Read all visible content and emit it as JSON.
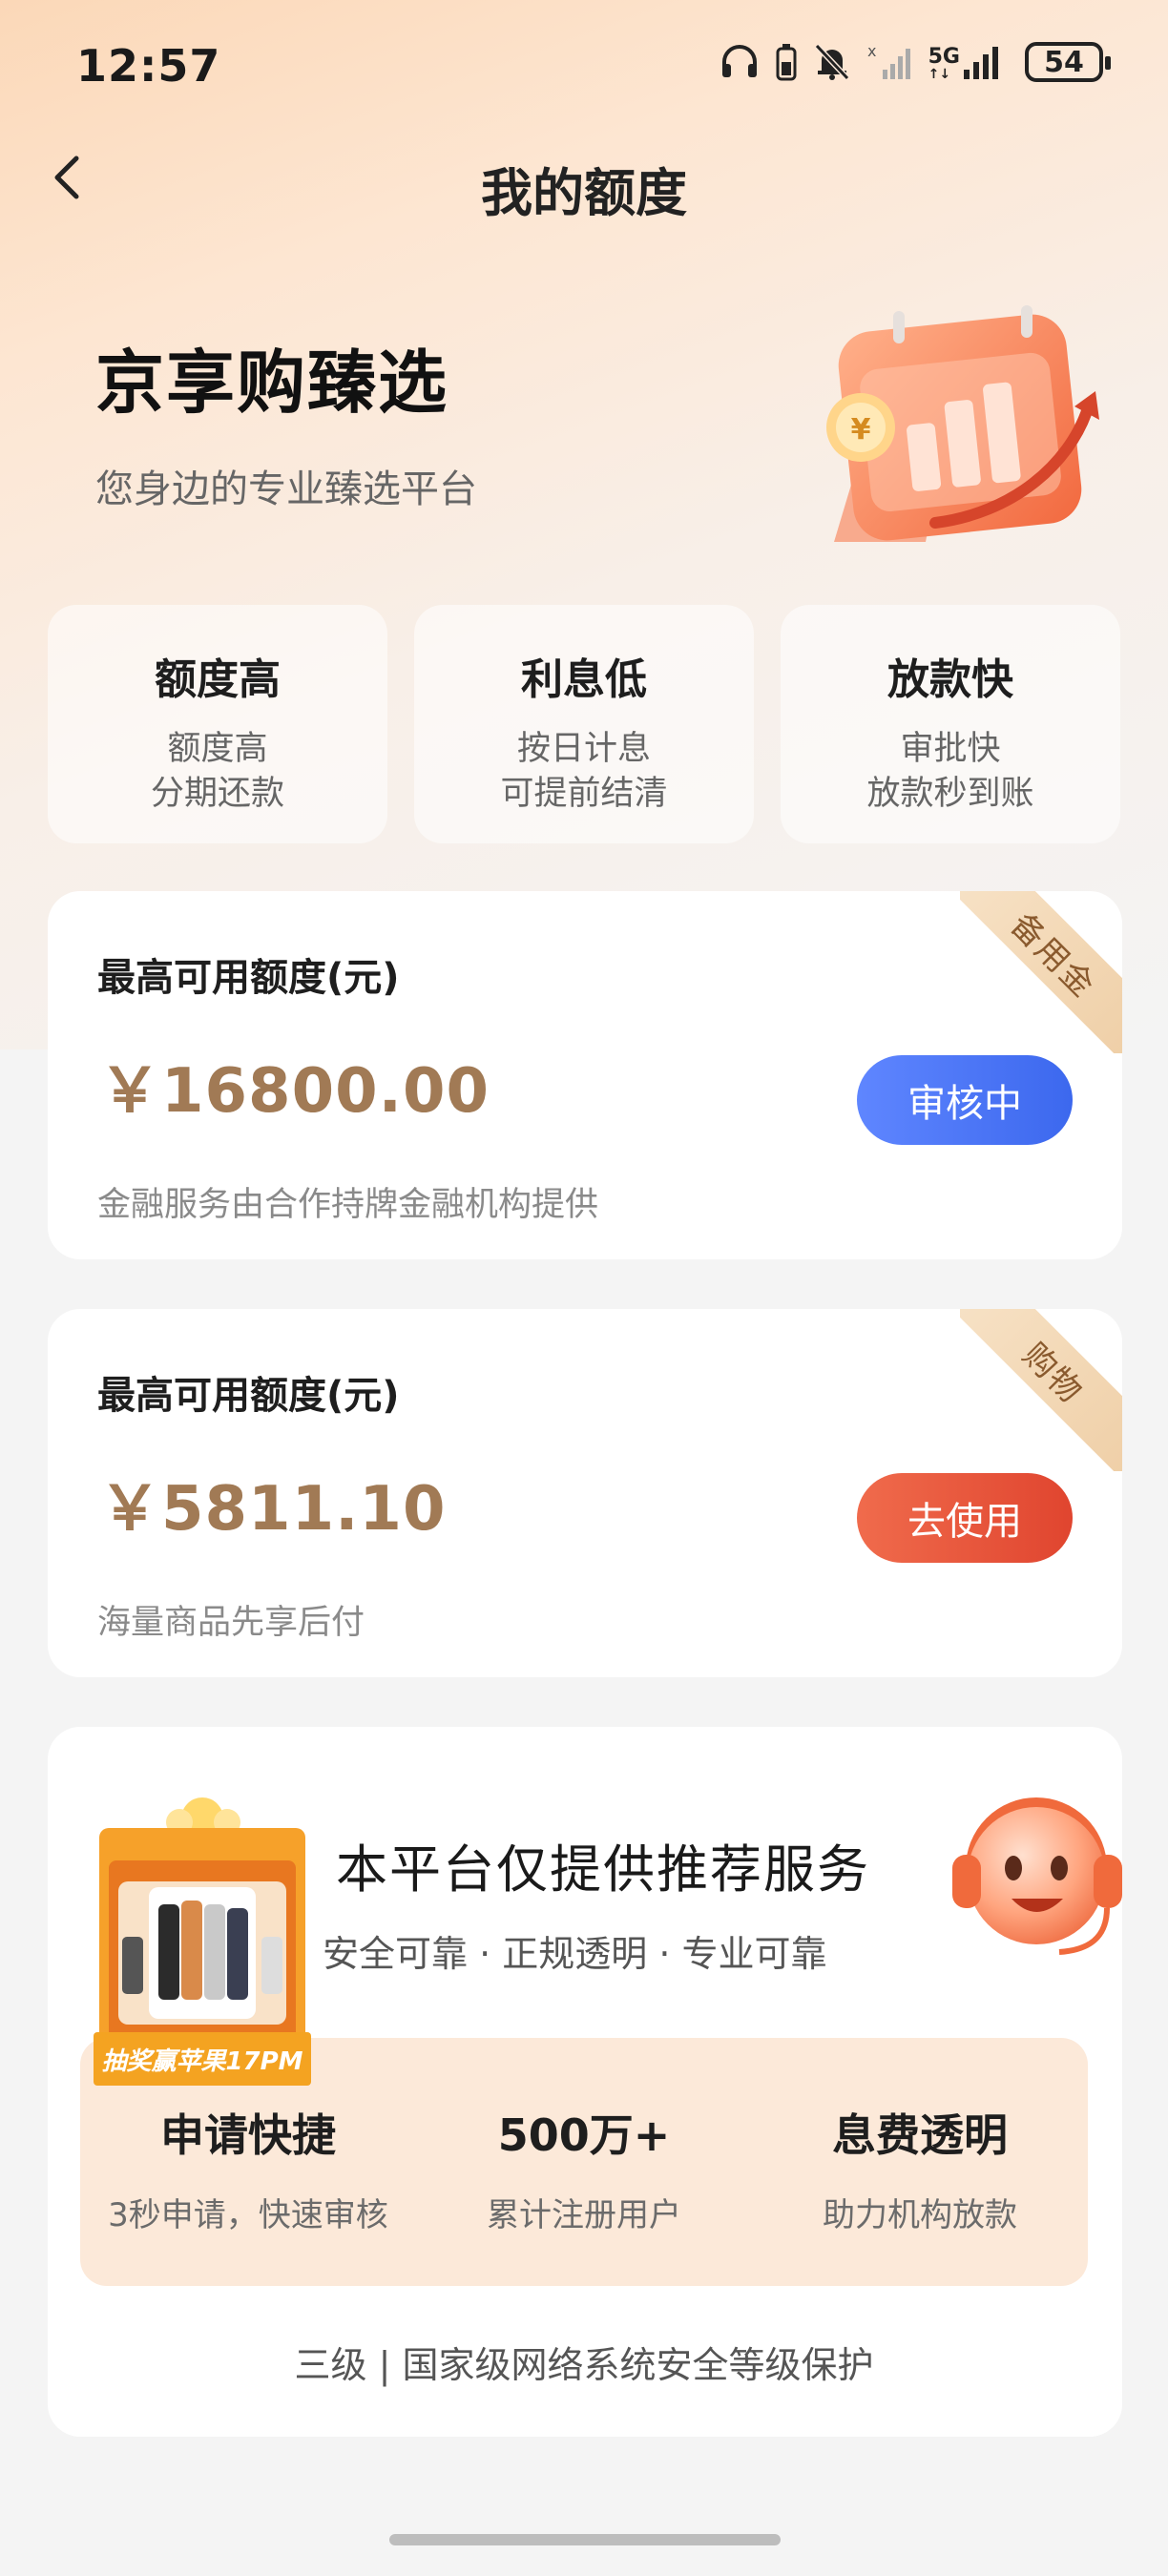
{
  "status_bar": {
    "time": "12:57",
    "network": "5G",
    "battery": "54",
    "icons": [
      "headphones-icon",
      "battery-small-icon",
      "mute-bell-icon",
      "signal-off-icon",
      "signal-5g-icon",
      "battery-icon"
    ]
  },
  "nav": {
    "back_icon": "chevron-left-icon",
    "title": "我的额度"
  },
  "hero": {
    "title": "京享购臻选",
    "subtitle": "您身边的专业臻选平台",
    "illustration": "calendar-chart-icon"
  },
  "features": [
    {
      "title": "额度高",
      "line1": "额度高",
      "line2": "分期还款"
    },
    {
      "title": "利息低",
      "line1": "按日计息",
      "line2": "可提前结清"
    },
    {
      "title": "放款快",
      "line1": "审批快",
      "line2": "放款秒到账"
    }
  ],
  "credit_cards": [
    {
      "label": "最高可用额度(元)",
      "amount": "￥16800.00",
      "description": "金融服务由合作持牌金融机构提供",
      "button": "审核中",
      "ribbon": "备用金",
      "button_color": "#4a74f5"
    },
    {
      "label": "最高可用额度(元)",
      "amount": "￥5811.10",
      "description": "海量商品先享后付",
      "button": "去使用",
      "ribbon": "购物",
      "button_color": "#e8533a"
    }
  ],
  "platform": {
    "promo_banner": "抽奖赢苹果17PM",
    "title": "本平台仅提供推荐服务",
    "subtitle": "安全可靠 · 正规透明 · 专业可靠",
    "mascot_icon": "headset-mascot-icon",
    "stats": [
      {
        "value": "申请快捷",
        "label": "3秒申请，快速审核"
      },
      {
        "value": "500万+",
        "label": "累计注册用户"
      },
      {
        "value": "息费透明",
        "label": "助力机构放款"
      }
    ],
    "security": "三级 | 国家级网络系统安全等级保护"
  },
  "colors": {
    "accent_gold": "#a17a55",
    "blue_button": "#4a74f5",
    "red_button": "#e8533a",
    "stats_bg": "#fce9d9"
  }
}
